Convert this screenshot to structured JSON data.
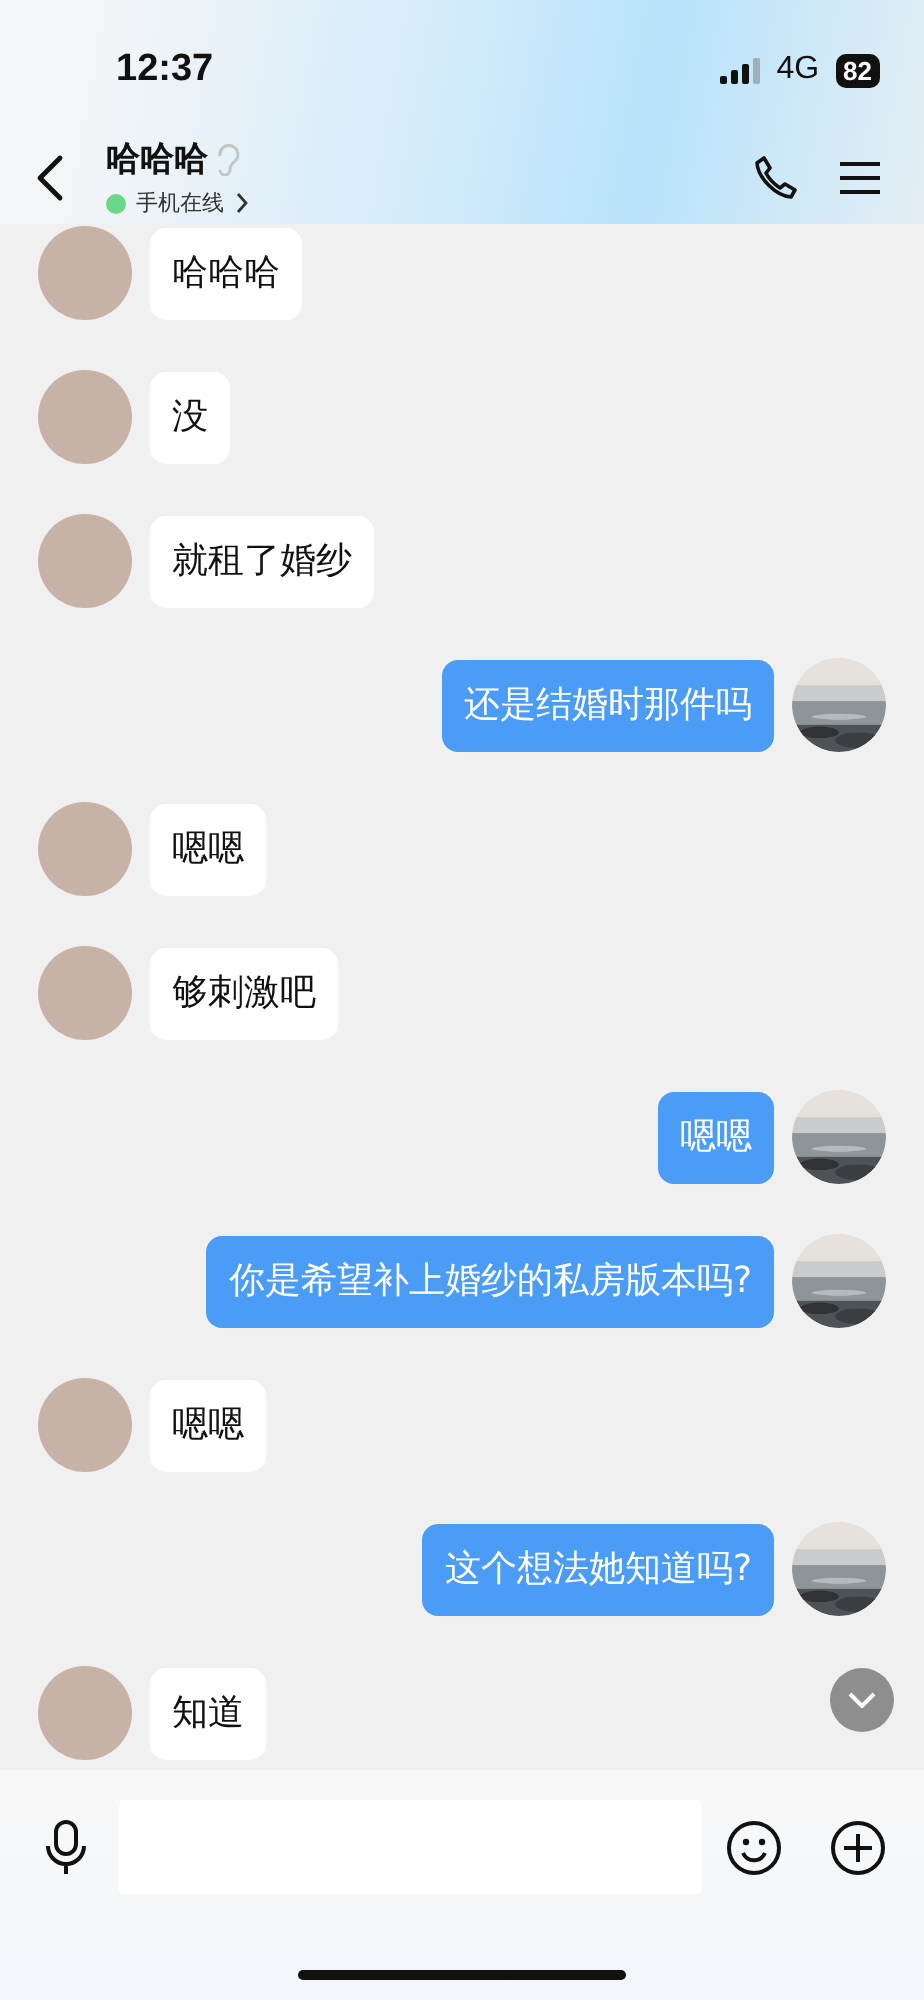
{
  "status_bar": {
    "time": "12:37",
    "network": "4G",
    "battery": "82"
  },
  "header": {
    "title": "哈哈哈",
    "online": true,
    "status": "手机在线"
  },
  "messages": [
    {
      "kind": "incoming",
      "text": "哈哈哈"
    },
    {
      "kind": "incoming",
      "text": "没"
    },
    {
      "kind": "incoming",
      "text": "就租了婚纱"
    },
    {
      "kind": "outgoing",
      "text": "还是结婚时那件吗"
    },
    {
      "kind": "incoming",
      "text": "嗯嗯"
    },
    {
      "kind": "incoming",
      "text": "够刺激吧"
    },
    {
      "kind": "outgoing",
      "text": "嗯嗯"
    },
    {
      "kind": "outgoing",
      "text": "你是希望补上婚纱的私房版本吗?"
    },
    {
      "kind": "incoming",
      "text": "嗯嗯"
    },
    {
      "kind": "outgoing",
      "text": "这个想法她知道吗?"
    },
    {
      "kind": "incoming",
      "text": "知道"
    }
  ]
}
